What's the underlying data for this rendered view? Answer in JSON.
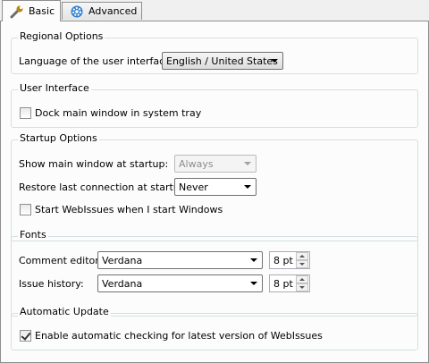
{
  "tabs": [
    {
      "label": "Basic",
      "icon": "wrench-icon",
      "active": true
    },
    {
      "label": "Advanced",
      "icon": "gear-icon",
      "active": false
    }
  ],
  "regional": {
    "title": "Regional Options",
    "language_label": "Language of the user interface:",
    "language_value": "English / United States"
  },
  "ui": {
    "title": "User Interface",
    "dock_label": "Dock main window in system tray",
    "dock_checked": false
  },
  "startup": {
    "title": "Startup Options",
    "show_label": "Show main window at startup:",
    "show_value": "Always",
    "restore_label": "Restore last connection at startup:",
    "restore_value": "Never",
    "start_label": "Start WebIssues when I start Windows",
    "start_checked": false
  },
  "fonts": {
    "title": "Fonts",
    "comment_label": "Comment editor:",
    "comment_font": "Verdana",
    "comment_size": "8 pt",
    "history_label": "Issue history:",
    "history_font": "Verdana",
    "history_size": "8 pt"
  },
  "update": {
    "title": "Automatic Update",
    "auto_label": "Enable automatic checking for latest version of WebIssues",
    "auto_checked": true
  }
}
